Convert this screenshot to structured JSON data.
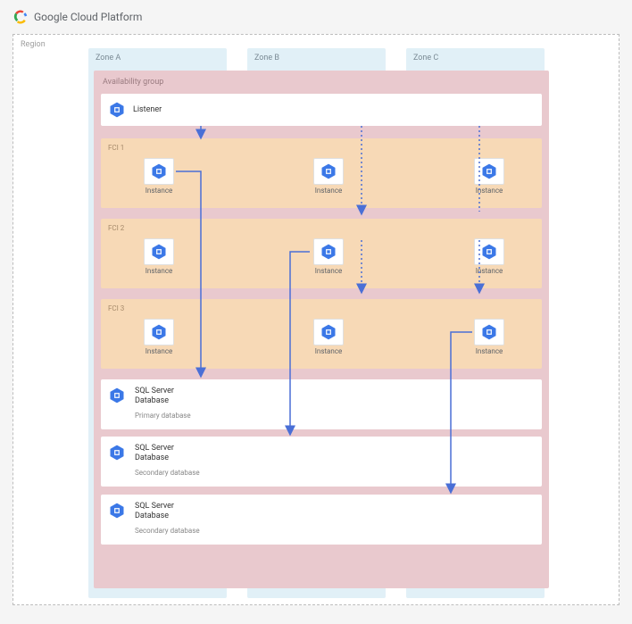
{
  "header": {
    "title": "Google Cloud Platform"
  },
  "region": {
    "label": "Region"
  },
  "zones": {
    "a": "Zone A",
    "b": "Zone B",
    "c": "Zone C"
  },
  "ag": {
    "label": "Availability group"
  },
  "listener": {
    "label": "Listener"
  },
  "fci": {
    "f1": "FCI 1",
    "f2": "FCI 2",
    "f3": "FCI 3"
  },
  "instance": {
    "label": "Instance"
  },
  "db": {
    "title": "SQL Server\nDatabase",
    "primary": "Primary database",
    "secondary": "Secondary database"
  },
  "colors": {
    "arrow": "#4a6fd6",
    "hex": "#3b78e7"
  }
}
